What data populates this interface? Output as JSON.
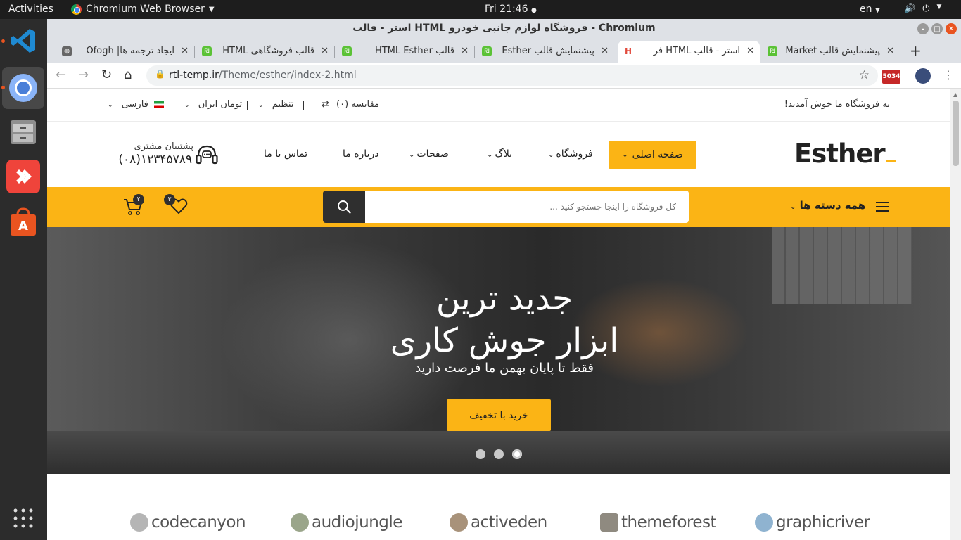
{
  "os": {
    "activities": "Activities",
    "app_name": "Chromium Web Browser",
    "clock": "Fri 21:46",
    "language": "en"
  },
  "window": {
    "title": "استر - قالب HTML فروشگاه لوازم جانبی خودرو - Chromium"
  },
  "tabs": [
    {
      "label": "ایجاد ترجمه ها| Ofogh",
      "active": false
    },
    {
      "label": "قالب فروشگاهی HTML",
      "active": false
    },
    {
      "label": "قالب HTML Esther",
      "active": false
    },
    {
      "label": "پیشنمایش قالب Esther",
      "active": false
    },
    {
      "label": "استر - قالب HTML فر",
      "active": true
    },
    {
      "label": "پیشنمایش قالب Market",
      "active": false
    }
  ],
  "toolbar": {
    "url_host": "rtl-temp.ir",
    "url_path": "/Theme/esther/index-2.html",
    "extension_badge": "5034"
  },
  "site": {
    "topbar": {
      "welcome": "به فروشگاه ما خوش آمدید!",
      "compare": "مقایسه (۰)",
      "settings": "تنظیم",
      "currency": "تومان ایران",
      "language": "فارسی"
    },
    "header": {
      "logo": "Esther",
      "nav": {
        "home": "صفحه اصلی",
        "shop": "فروشگاه",
        "blog": "بلاگ",
        "pages": "صفحات",
        "about": "درباره ما",
        "contact": "تماس با ما"
      },
      "support_label": "پشتیبان مشتری",
      "support_phone": "۱۲۳۴۵۷۸۹(۰۸)"
    },
    "search": {
      "all_categories": "همه دسته ها",
      "placeholder": "کل فروشگاه را اینجا جستجو کنید ...",
      "wishlist_count": "۳",
      "cart_count": "۲"
    },
    "hero": {
      "title_line1": "جدید ترین",
      "title_line2": "ابزار جوش کاری",
      "subtitle": "فقط تا پایان بهمن ما فرصت دارید",
      "cta": "خرید با تخفیف",
      "slide_count": 3,
      "active_slide": 1
    },
    "brands": [
      "codecanyon",
      "audiojungle",
      "activeden",
      "themeforest",
      "graphicriver"
    ]
  },
  "colors": {
    "accent": "#fbb415",
    "dark": "#2f2f2f"
  }
}
